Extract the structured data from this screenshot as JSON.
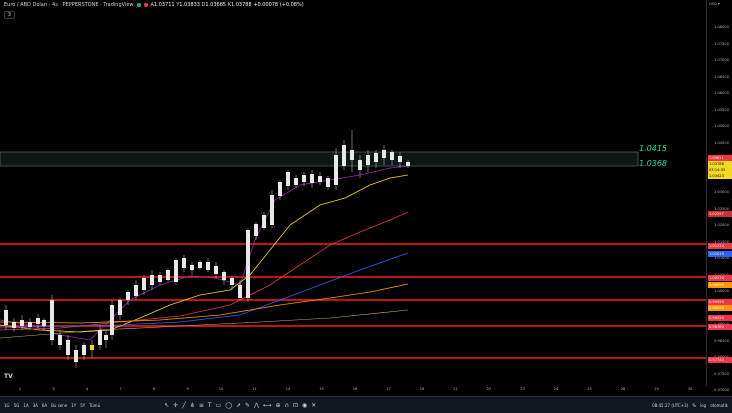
{
  "legend": {
    "title": "Euro / ABD Doları · 4s · PEPPERSTONE · TradingView",
    "ohlc": [
      {
        "key": "A",
        "value": "1.03711"
      },
      {
        "key": "Y",
        "value": "1.03833"
      },
      {
        "key": "D",
        "value": "1.03685"
      },
      {
        "key": "K",
        "value": "1.03788"
      }
    ],
    "change": "+0.00078 (+0.08%)",
    "status_colors": [
      "#26a69a",
      "#f23645"
    ]
  },
  "collapse_label": "3",
  "currency": "USD ▾",
  "zones": {
    "upper": "1.0415",
    "lower": "1.0368"
  },
  "price_axis": {
    "labels": [
      "1.08000",
      "1.07500",
      "1.07000",
      "1.06500",
      "1.06000",
      "1.05500",
      "1.05000",
      "1.04500",
      "1.04000",
      "1.03500",
      "1.03000",
      "1.02500",
      "1.02000",
      "1.01500",
      "1.01000",
      "1.00500",
      "1.00000",
      "0.99500",
      "0.99000",
      "0.98500",
      "0.98000",
      "0.97500",
      "0.97000"
    ],
    "tags": [
      {
        "text": "1.03811",
        "color": "#f23645"
      },
      {
        "text": "1.03788",
        "color": "#f5d923"
      },
      {
        "text": "03:14:33",
        "color": "#f5d923"
      },
      {
        "text": "1.03423",
        "color": "#f5d923"
      },
      {
        "text": "1.02257",
        "color": "#d32f2f"
      },
      {
        "text": "1.01270",
        "color": "#f23645"
      },
      {
        "text": "1.01019",
        "color": "#2962ff"
      },
      {
        "text": "1.00270",
        "color": "#f23645"
      },
      {
        "text": "1.00099",
        "color": "#ff9800"
      },
      {
        "text": "0.99550",
        "color": "#f23645"
      },
      {
        "text": "0.99256",
        "color": "#ff9800"
      },
      {
        "text": "0.99220",
        "color": "#f23645"
      },
      {
        "text": "0.98780",
        "color": "#f23645"
      },
      {
        "text": "0.97740",
        "color": "#f23645"
      }
    ]
  },
  "time_axis": [
    "2",
    "3",
    "4",
    "7",
    "8",
    "9",
    "10",
    "11",
    "14",
    "15",
    "16",
    "17",
    "18",
    "21",
    "22",
    "23",
    "24",
    "25",
    "28",
    "29",
    "30"
  ],
  "ranges": [
    "1G",
    "5G",
    "1A",
    "3A",
    "6A",
    "Bu sene",
    "1Y",
    "5Y",
    "Tümü"
  ],
  "tools": [
    "cursor-icon",
    "crosshair-icon",
    "trendline-icon",
    "pitchfork-icon",
    "fib-icon",
    "text-icon",
    "rectangle-icon",
    "ellipse-icon",
    "arrow-icon",
    "brush-icon",
    "pattern-icon",
    "measure-icon",
    "zoom-icon",
    "magnet-icon",
    "lock-icon",
    "eye-icon",
    "trash-icon"
  ],
  "status_right": {
    "time": "08:45:27 (UTC+3)",
    "percent": "%",
    "log": "log",
    "auto": "otomatik"
  },
  "chart_data": {
    "type": "candlestick",
    "y_range": [
      0.965,
      1.087
    ],
    "horizontal_levels": [
      1.0127,
      1.0027,
      0.9955,
      0.9878,
      0.9774
    ],
    "zone": [
      1.0368,
      1.0415
    ]
  }
}
